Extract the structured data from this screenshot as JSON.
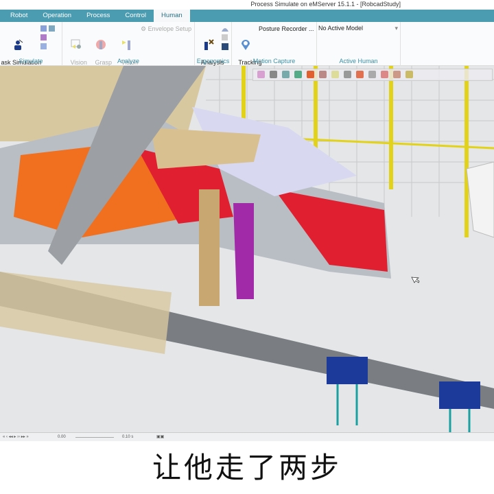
{
  "window": {
    "title": "Process Simulate on eMServer 15.1.1 - [RobcadStudy]"
  },
  "tabs": [
    {
      "label": "Robot"
    },
    {
      "label": "Operation"
    },
    {
      "label": "Process"
    },
    {
      "label": "Control"
    },
    {
      "label": "Human",
      "active": true
    }
  ],
  "ribbon": {
    "simulate": {
      "label": "Simulate",
      "task_builder": "ask Simulation\nBuilder"
    },
    "analyze": {
      "label": "Analyze",
      "vision_window": "Vision\nWindow",
      "grasp_envelope": "Grasp\nEnvelope",
      "vision_envelope": "Vision\nEnvelope",
      "envelope_setup": "Envelope Setup"
    },
    "ergonomics": {
      "label": "Ergonomics",
      "analysis_tools": "Analysis\nTools▾"
    },
    "motion_capture": {
      "label": "Motion Capture",
      "tracking_setup": "Tracking\nSetup▾",
      "posture_recorder": "Posture Recorder ..."
    },
    "active_human": {
      "label": "Active Human",
      "selected": "No Active Model"
    }
  },
  "status": {
    "time": "0.00",
    "step": "0.10 s"
  },
  "subtitle": "让他走了两步",
  "colors": {
    "tab_bar": "#4b9cb0",
    "accent": "#3b8fa6"
  }
}
